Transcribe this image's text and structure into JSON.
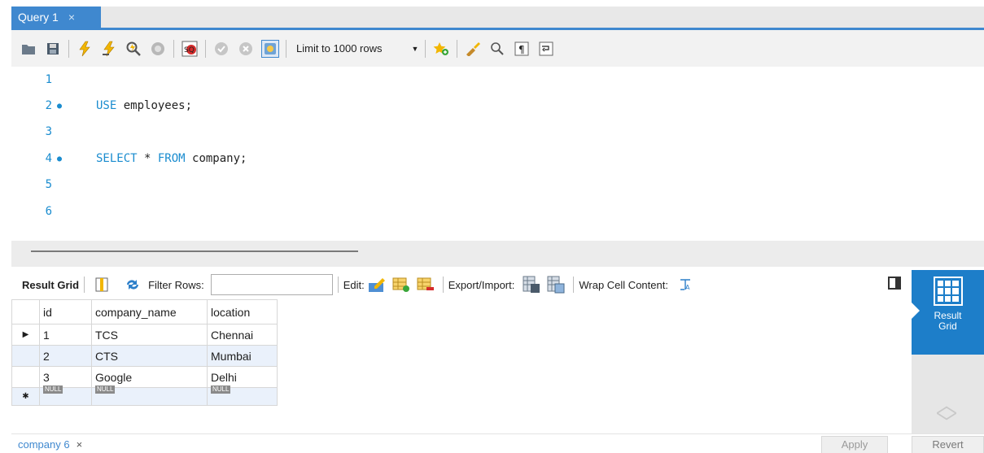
{
  "tab": {
    "title": "Query 1",
    "close": "×"
  },
  "toolbar": {
    "limit_label": "Limit to 1000 rows",
    "icons": [
      "folder-icon",
      "save-icon",
      "execute-icon",
      "execute-current-icon",
      "explain-icon",
      "stop-icon",
      "toggle-error-icon",
      "commit-icon",
      "rollback-icon",
      "autocommit-icon",
      "bookmark-icon",
      "beautify-icon",
      "find-icon",
      "invisible-chars-icon",
      "wrap-icon"
    ]
  },
  "editor": {
    "lines": [
      {
        "num": "1",
        "marker": "",
        "keyword": "",
        "rest": ""
      },
      {
        "num": "2",
        "marker": "●",
        "keyword": "USE",
        "rest": " employees;"
      },
      {
        "num": "3",
        "marker": "",
        "keyword": "",
        "rest": ""
      },
      {
        "num": "4",
        "marker": "●",
        "keyword": "SELECT",
        "rest": " * ",
        "keyword2": "FROM",
        "rest2": " company;"
      },
      {
        "num": "5",
        "marker": "",
        "keyword": "",
        "rest": ""
      },
      {
        "num": "6",
        "marker": "",
        "keyword": "",
        "rest": ""
      }
    ]
  },
  "result_toolbar": {
    "result_grid": "Result Grid",
    "filter_rows": "Filter Rows:",
    "edit": "Edit:",
    "export_import": "Export/Import:",
    "wrap_cell": "Wrap Cell Content:"
  },
  "grid": {
    "columns": [
      "id",
      "company_name",
      "location"
    ],
    "rows": [
      [
        "1",
        "TCS",
        "Chennai"
      ],
      [
        "2",
        "CTS",
        "Mumbai"
      ],
      [
        "3",
        "Google",
        "Delhi"
      ]
    ],
    "null_label": "NULL",
    "current_row_marker": "▶",
    "new_row_marker": "✱"
  },
  "side_panel": {
    "result_grid_line1": "Result",
    "result_grid_line2": "Grid"
  },
  "bottom": {
    "result_tab": "company 6",
    "close": "×",
    "apply": "Apply",
    "revert": "Revert"
  },
  "colors": {
    "accent": "#3f88cf",
    "side_active": "#1d7ec9",
    "keyword": "#1a8ccf"
  }
}
